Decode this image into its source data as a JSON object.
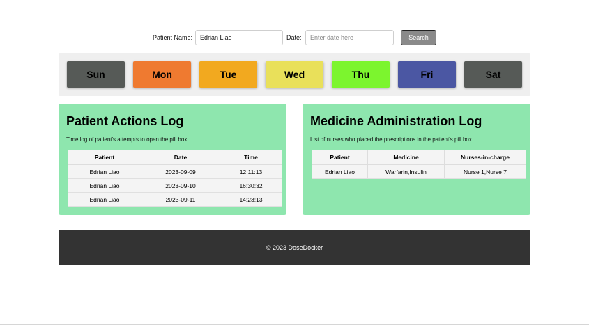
{
  "search": {
    "name_label": "Patient Name:",
    "name_value": "Edrian Liao",
    "date_label": "Date:",
    "date_placeholder": "Enter date here",
    "button_label": "Search"
  },
  "days": [
    {
      "label": "Sun",
      "color": "#565a57"
    },
    {
      "label": "Mon",
      "color": "#ef7a30"
    },
    {
      "label": "Tue",
      "color": "#f2a91f"
    },
    {
      "label": "Wed",
      "color": "#e9e05a"
    },
    {
      "label": "Thu",
      "color": "#7cf52e"
    },
    {
      "label": "Fri",
      "color": "#4b57a3"
    },
    {
      "label": "Sat",
      "color": "#565a57"
    }
  ],
  "actions_log": {
    "title": "Patient Actions Log",
    "description": "Time log of patient's attempts to open the pill box.",
    "columns": [
      "Patient",
      "Date",
      "Time"
    ],
    "rows": [
      [
        "Edrian Liao",
        "2023-09-09",
        "12:11:13"
      ],
      [
        "Edrian Liao",
        "2023-09-10",
        "16:30:32"
      ],
      [
        "Edrian Liao",
        "2023-09-11",
        "14:23:13"
      ]
    ]
  },
  "medicine_log": {
    "title": "Medicine Administration Log",
    "description": "List of nurses who placed the prescriptions in the patient's pill box.",
    "columns": [
      "Patient",
      "Medicine",
      "Nurses-in-charge"
    ],
    "rows": [
      [
        "Edrian Liao",
        "Warfarin,Insulin",
        "Nurse 1,Nurse 7"
      ]
    ]
  },
  "footer": {
    "text": "© 2023 DoseDocker"
  },
  "colors": {
    "panel_bg": "#8ee6ae",
    "footer_bg": "#333333",
    "search_button": "#8a8a8a"
  }
}
